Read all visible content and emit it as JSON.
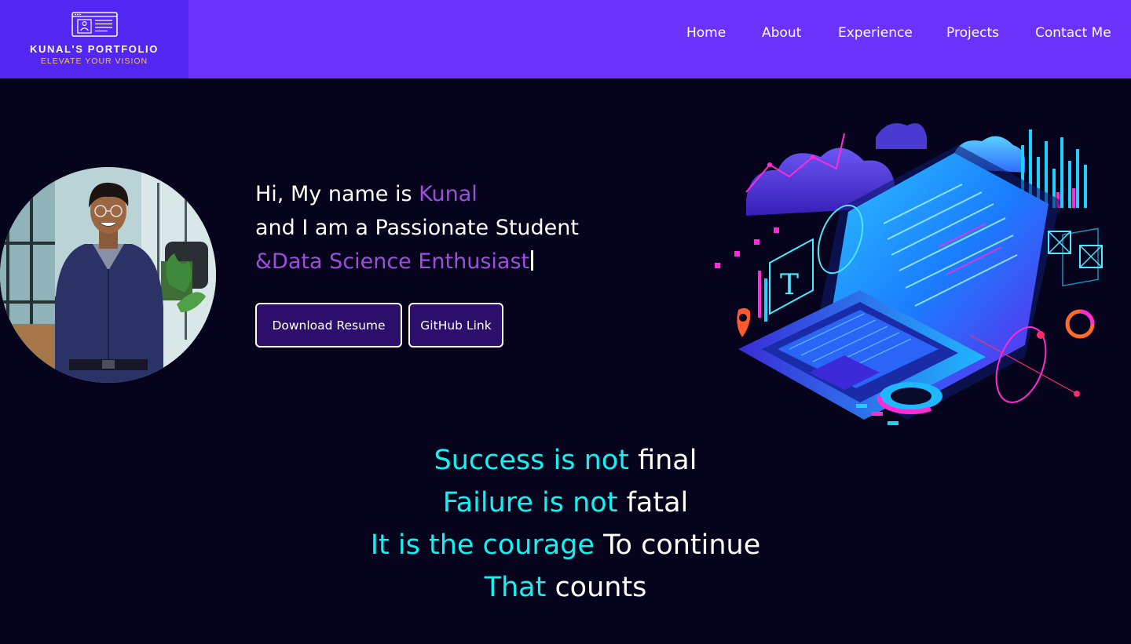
{
  "logo": {
    "title": "KUNAL'S PORTFOLIO",
    "tagline": "ELEVATE YOUR VISION",
    "icon": "profile-window-icon"
  },
  "nav": {
    "items": [
      {
        "label": "Home"
      },
      {
        "label": "About"
      },
      {
        "label": "Experience"
      },
      {
        "label": "Projects"
      },
      {
        "label": "Contact Me"
      }
    ]
  },
  "intro": {
    "greeting": "Hi, My name is ",
    "name": "Kunal",
    "line2": "and I am a Passionate Student",
    "line3": "&Data Science Enthusiast"
  },
  "buttons": {
    "resume": "Download Resume",
    "github": "GitHub Link"
  },
  "quote": {
    "lines": [
      {
        "highlight": "Success is not",
        "rest": "final"
      },
      {
        "highlight": "Failure is not",
        "rest": "fatal"
      },
      {
        "highlight": "It is the courage",
        "rest": "To continue"
      },
      {
        "highlight": "That",
        "rest": "counts"
      }
    ]
  },
  "colors": {
    "navbar": "#6a32fb",
    "background": "#05041c",
    "accent_purple": "#9d4fdb",
    "accent_cyan": "#12f2f2",
    "tagline_gold": "#f3c44a"
  }
}
